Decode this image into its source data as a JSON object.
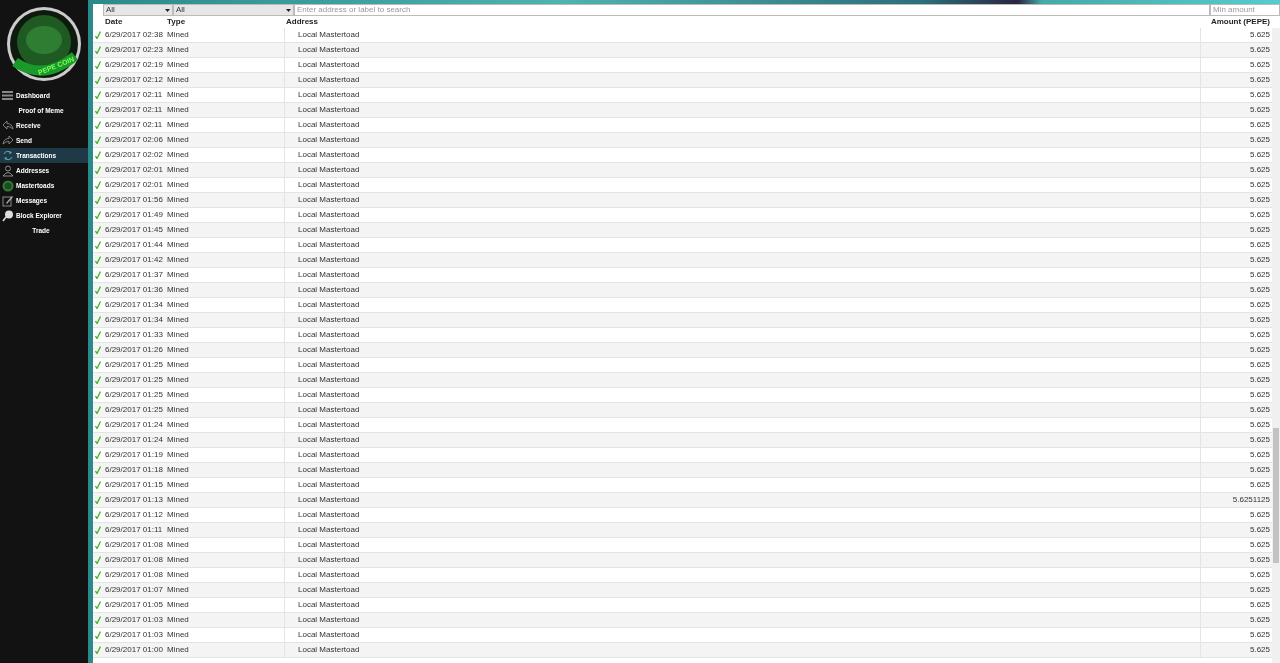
{
  "logo": {
    "text": "PEPE COIN"
  },
  "sidebar": {
    "items": [
      {
        "label": "Dashboard",
        "kind": "main",
        "selected": false
      },
      {
        "label": "Proof of Meme",
        "kind": "sub",
        "selected": false
      },
      {
        "label": "Receive",
        "kind": "main",
        "selected": false
      },
      {
        "label": "Send",
        "kind": "main",
        "selected": false
      },
      {
        "label": "Transactions",
        "kind": "main",
        "selected": true
      },
      {
        "label": "Addresses",
        "kind": "main",
        "selected": false
      },
      {
        "label": "Mastertoads",
        "kind": "main",
        "selected": false
      },
      {
        "label": "Messages",
        "kind": "main",
        "selected": false
      },
      {
        "label": "Block Explorer",
        "kind": "main",
        "selected": false
      },
      {
        "label": "Trade",
        "kind": "sub",
        "selected": false
      }
    ]
  },
  "filters": {
    "date": "All",
    "type": "All",
    "search": {
      "placeholder": "Enter address or label to search"
    },
    "min_amount": {
      "placeholder": "Min amount"
    }
  },
  "table": {
    "columns": [
      "Date",
      "Type",
      "Address",
      "Amount (PEPE)"
    ],
    "rows": [
      {
        "confirmed": true,
        "date": "6/29/2017 02:38",
        "type": "Mined",
        "address": "Local Mastertoad",
        "amount": "5.625"
      },
      {
        "confirmed": true,
        "date": "6/29/2017 02:23",
        "type": "Mined",
        "address": "Local Mastertoad",
        "amount": "5.625"
      },
      {
        "confirmed": true,
        "date": "6/29/2017 02:19",
        "type": "Mined",
        "address": "Local Mastertoad",
        "amount": "5.625"
      },
      {
        "confirmed": true,
        "date": "6/29/2017 02:12",
        "type": "Mined",
        "address": "Local Mastertoad",
        "amount": "5.625"
      },
      {
        "confirmed": true,
        "date": "6/29/2017 02:11",
        "type": "Mined",
        "address": "Local Mastertoad",
        "amount": "5.625"
      },
      {
        "confirmed": true,
        "date": "6/29/2017 02:11",
        "type": "Mined",
        "address": "Local Mastertoad",
        "amount": "5.625"
      },
      {
        "confirmed": true,
        "date": "6/29/2017 02:11",
        "type": "Mined",
        "address": "Local Mastertoad",
        "amount": "5.625"
      },
      {
        "confirmed": true,
        "date": "6/29/2017 02:06",
        "type": "Mined",
        "address": "Local Mastertoad",
        "amount": "5.625"
      },
      {
        "confirmed": true,
        "date": "6/29/2017 02:02",
        "type": "Mined",
        "address": "Local Mastertoad",
        "amount": "5.625"
      },
      {
        "confirmed": true,
        "date": "6/29/2017 02:01",
        "type": "Mined",
        "address": "Local Mastertoad",
        "amount": "5.625"
      },
      {
        "confirmed": true,
        "date": "6/29/2017 02:01",
        "type": "Mined",
        "address": "Local Mastertoad",
        "amount": "5.625"
      },
      {
        "confirmed": true,
        "date": "6/29/2017 01:56",
        "type": "Mined",
        "address": "Local Mastertoad",
        "amount": "5.625"
      },
      {
        "confirmed": true,
        "date": "6/29/2017 01:49",
        "type": "Mined",
        "address": "Local Mastertoad",
        "amount": "5.625"
      },
      {
        "confirmed": true,
        "date": "6/29/2017 01:45",
        "type": "Mined",
        "address": "Local Mastertoad",
        "amount": "5.625"
      },
      {
        "confirmed": true,
        "date": "6/29/2017 01:44",
        "type": "Mined",
        "address": "Local Mastertoad",
        "amount": "5.625"
      },
      {
        "confirmed": true,
        "date": "6/29/2017 01:42",
        "type": "Mined",
        "address": "Local Mastertoad",
        "amount": "5.625"
      },
      {
        "confirmed": true,
        "date": "6/29/2017 01:37",
        "type": "Mined",
        "address": "Local Mastertoad",
        "amount": "5.625"
      },
      {
        "confirmed": true,
        "date": "6/29/2017 01:36",
        "type": "Mined",
        "address": "Local Mastertoad",
        "amount": "5.625"
      },
      {
        "confirmed": true,
        "date": "6/29/2017 01:34",
        "type": "Mined",
        "address": "Local Mastertoad",
        "amount": "5.625"
      },
      {
        "confirmed": true,
        "date": "6/29/2017 01:34",
        "type": "Mined",
        "address": "Local Mastertoad",
        "amount": "5.625"
      },
      {
        "confirmed": true,
        "date": "6/29/2017 01:33",
        "type": "Mined",
        "address": "Local Mastertoad",
        "amount": "5.625"
      },
      {
        "confirmed": true,
        "date": "6/29/2017 01:26",
        "type": "Mined",
        "address": "Local Mastertoad",
        "amount": "5.625"
      },
      {
        "confirmed": true,
        "date": "6/29/2017 01:25",
        "type": "Mined",
        "address": "Local Mastertoad",
        "amount": "5.625"
      },
      {
        "confirmed": true,
        "date": "6/29/2017 01:25",
        "type": "Mined",
        "address": "Local Mastertoad",
        "amount": "5.625"
      },
      {
        "confirmed": true,
        "date": "6/29/2017 01:25",
        "type": "Mined",
        "address": "Local Mastertoad",
        "amount": "5.625"
      },
      {
        "confirmed": true,
        "date": "6/29/2017 01:25",
        "type": "Mined",
        "address": "Local Mastertoad",
        "amount": "5.625"
      },
      {
        "confirmed": true,
        "date": "6/29/2017 01:24",
        "type": "Mined",
        "address": "Local Mastertoad",
        "amount": "5.625"
      },
      {
        "confirmed": true,
        "date": "6/29/2017 01:24",
        "type": "Mined",
        "address": "Local Mastertoad",
        "amount": "5.625"
      },
      {
        "confirmed": true,
        "date": "6/29/2017 01:19",
        "type": "Mined",
        "address": "Local Mastertoad",
        "amount": "5.625"
      },
      {
        "confirmed": true,
        "date": "6/29/2017 01:18",
        "type": "Mined",
        "address": "Local Mastertoad",
        "amount": "5.625"
      },
      {
        "confirmed": true,
        "date": "6/29/2017 01:15",
        "type": "Mined",
        "address": "Local Mastertoad",
        "amount": "5.625"
      },
      {
        "confirmed": true,
        "date": "6/29/2017 01:13",
        "type": "Mined",
        "address": "Local Mastertoad",
        "amount": "5.6251125"
      },
      {
        "confirmed": true,
        "date": "6/29/2017 01:12",
        "type": "Mined",
        "address": "Local Mastertoad",
        "amount": "5.625"
      },
      {
        "confirmed": true,
        "date": "6/29/2017 01:11",
        "type": "Mined",
        "address": "Local Mastertoad",
        "amount": "5.625"
      },
      {
        "confirmed": true,
        "date": "6/29/2017 01:08",
        "type": "Mined",
        "address": "Local Mastertoad",
        "amount": "5.625"
      },
      {
        "confirmed": true,
        "date": "6/29/2017 01:08",
        "type": "Mined",
        "address": "Local Mastertoad",
        "amount": "5.625"
      },
      {
        "confirmed": true,
        "date": "6/29/2017 01:08",
        "type": "Mined",
        "address": "Local Mastertoad",
        "amount": "5.625"
      },
      {
        "confirmed": true,
        "date": "6/29/2017 01:07",
        "type": "Mined",
        "address": "Local Mastertoad",
        "amount": "5.625"
      },
      {
        "confirmed": true,
        "date": "6/29/2017 01:05",
        "type": "Mined",
        "address": "Local Mastertoad",
        "amount": "5.625"
      },
      {
        "confirmed": true,
        "date": "6/29/2017 01:03",
        "type": "Mined",
        "address": "Local Mastertoad",
        "amount": "5.625"
      },
      {
        "confirmed": true,
        "date": "6/29/2017 01:03",
        "type": "Mined",
        "address": "Local Mastertoad",
        "amount": "5.625"
      },
      {
        "confirmed": true,
        "date": "6/29/2017 01:00",
        "type": "Mined",
        "address": "Local Mastertoad",
        "amount": "5.625"
      }
    ]
  }
}
